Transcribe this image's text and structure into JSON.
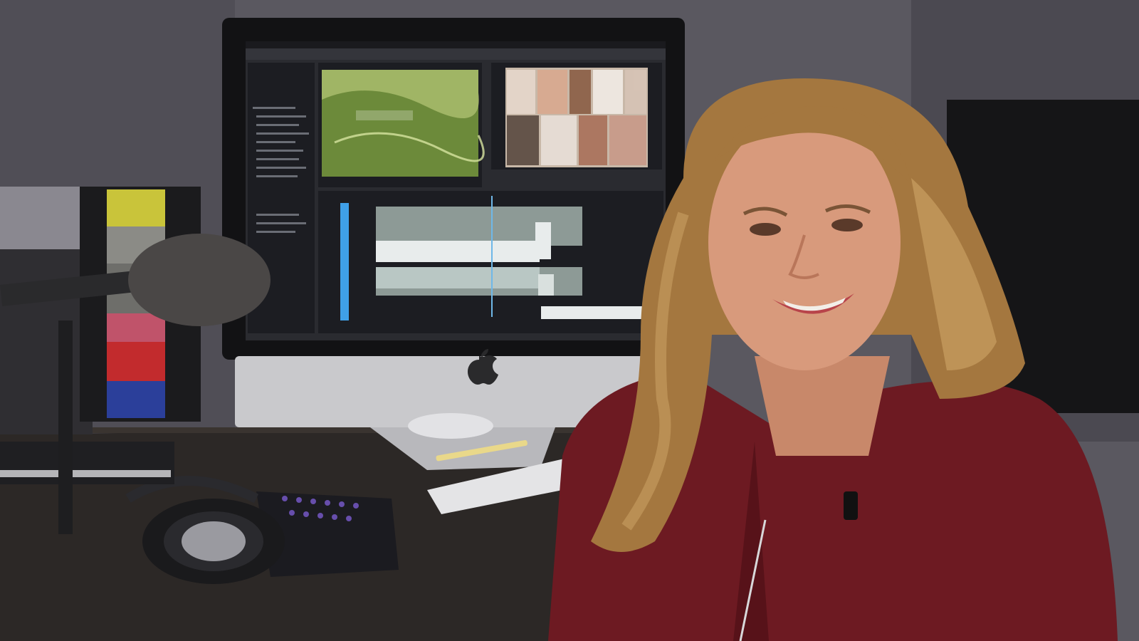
{
  "scene": {
    "description_visible_text": [],
    "colors": {
      "wall": "#5a5860",
      "wall_shadow": "#3e3c44",
      "desk": "#2c2826",
      "desk_edge": "#3a3430",
      "monitor_bezel": "#121214",
      "monitor_chin": "#c9c9cc",
      "monitor_stand": "#b8b8bc",
      "screen_bg": "#2a2b30",
      "panel_dark": "#1c1d22",
      "panel_mid": "#3b3d44",
      "timeline_track": "#8d9a96",
      "clip_white": "#e8ecec",
      "playhead_blue": "#3fa0e8",
      "map_green": "#6c8a3a",
      "map_light": "#b6c777",
      "shirt": "#6d1a22",
      "shirt_shadow": "#4e1016",
      "hair": "#a4773f",
      "hair_light": "#c9a062",
      "skin": "#d89a7c",
      "skin_shadow": "#b9765a",
      "mic_foam": "#4a4746",
      "chart_yellow": "#c9c43a",
      "chart_gray": "#8b8b86",
      "chart_pink": "#c0536a",
      "chart_red": "#c22b2d",
      "chart_blue": "#2b3f9a",
      "keyboard": "#e4e4e6",
      "headphones": "#1a1a1c",
      "gaming_keys": "#7a5bd0",
      "speaker": "#151517"
    }
  }
}
